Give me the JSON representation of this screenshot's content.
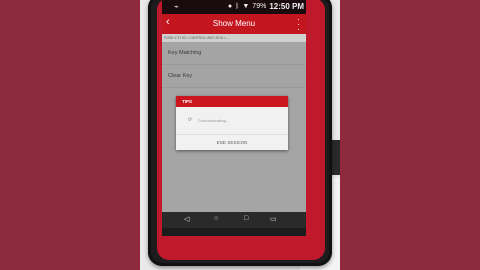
{
  "status_bar": {
    "left_icon": "usb-icon",
    "location_icon": "location-icon",
    "bluetooth_icon": "bluetooth-icon",
    "wifi_icon": "wifi-icon",
    "battery": "79%",
    "time": "12:50 PM"
  },
  "titlebar": {
    "title": "Show Menu",
    "back_icon": "back-arrow-icon",
    "more_icon": "more-vertical-icon"
  },
  "breadcrumb": "FORD V 37.00 > CONTROL UNIT, 2019 > ...",
  "menu": {
    "items": [
      {
        "label": "Key Matching"
      },
      {
        "label": "Clear Key"
      }
    ]
  },
  "dialog": {
    "header": "TIPS",
    "message": "Communicating...",
    "end_button": "END SESSION"
  },
  "navbar": {
    "back": "back-triangle-icon",
    "home": "home-circle-icon",
    "recent": "recent-square-icon",
    "screenshot": "screenshot-icon"
  },
  "colors": {
    "accent": "#c4161f",
    "background": "#8e2a3e"
  }
}
